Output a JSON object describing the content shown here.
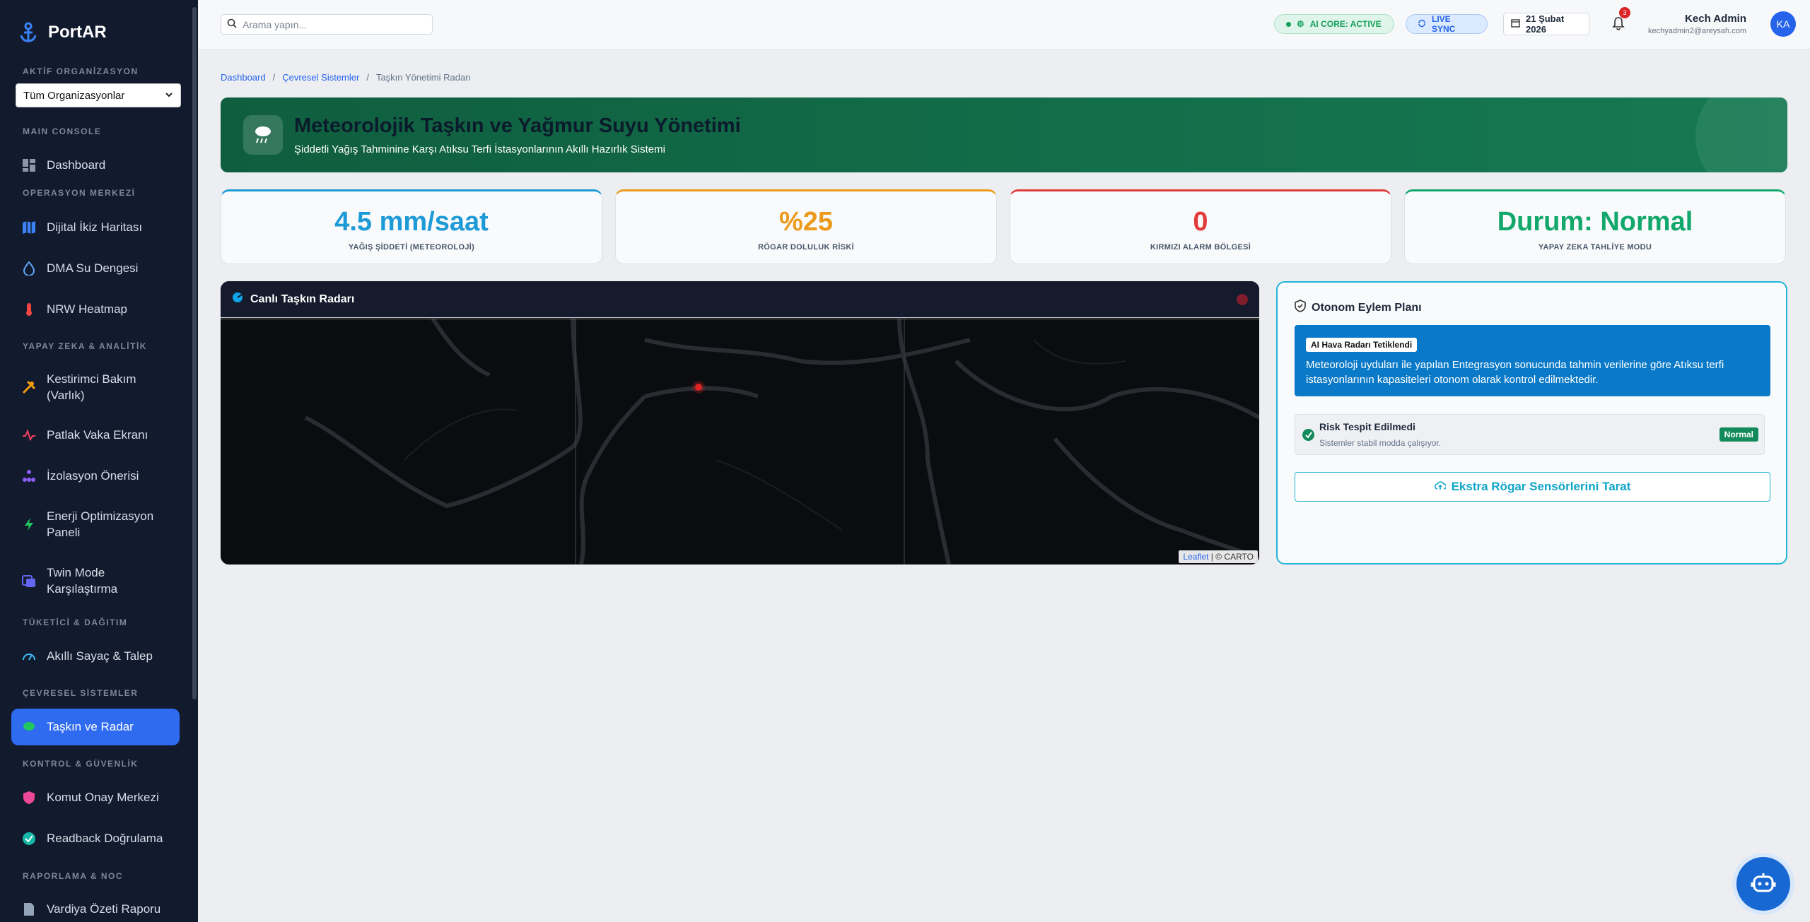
{
  "brand": {
    "name": "PortAR"
  },
  "sidebar": {
    "org_label": "AKTİF ORGANİZASYON",
    "org_value": "Tüm Organizasyonlar",
    "sections": {
      "main": "MAIN CONSOLE",
      "ops": "OPERASYON MERKEZİ",
      "ai": "YAPAY ZEKA & ANALİTİK",
      "consumer": "TÜKETİCİ & DAĞITIM",
      "env": "ÇEVRESEL SİSTEMLER",
      "control": "KONTROL & GÜVENLİK",
      "report": "RAPORLAMA & NOC"
    },
    "items": {
      "dashboard": "Dashboard",
      "digital_twin": "Dijital İkiz Haritası",
      "dma": "DMA Su Dengesi",
      "nrw": "NRW Heatmap",
      "predictive_1": "Kestirimci Bakım",
      "predictive_2": "(Varlık)",
      "burst": "Patlak Vaka Ekranı",
      "isolation": "İzolasyon Önerisi",
      "energy_1": "Enerji Optimizasyon",
      "energy_2": "Paneli",
      "twin_1": "Twin Mode",
      "twin_2": "Karşılaştırma",
      "meter": "Akıllı Sayaç & Talep",
      "flood": "Taşkın ve Radar",
      "approval": "Komut Onay Merkezi",
      "readback": "Readback Doğrulama",
      "shift": "Vardiya Özeti Raporu"
    }
  },
  "topbar": {
    "search_placeholder": "Arama yapın...",
    "ai_core": "AI CORE: ACTIVE",
    "live_sync": "LIVE SYNC",
    "date": "21 Şubat 2026",
    "notif_count": "3",
    "user_name": "Kech Admin",
    "user_email": "kechyadmin2@areysah.com",
    "avatar": "KA"
  },
  "breadcrumb": {
    "home": "Dashboard",
    "parent": "Çevresel Sistemler",
    "current": "Taşkın Yönetimi Radarı",
    "sep": "/"
  },
  "hero": {
    "title": "Meteorolojik Taşkın ve Yağmur Suyu Yönetimi",
    "subtitle": "Şiddetli Yağış Tahminine Karşı Atıksu Terfi İstasyonlarının Akıllı Hazırlık Sistemi"
  },
  "stats": [
    {
      "value": "4.5 mm/saat",
      "label": "YAĞIŞ ŞİDDETİ (METEOROLOJİ)",
      "color": "#1e9bd7"
    },
    {
      "value": "%25",
      "label": "RÖGAR DOLULUK RİSKİ",
      "color": "#ec9a1b"
    },
    {
      "value": "0",
      "label": "KIRMIZI ALARM BÖLGESİ",
      "color": "#e23b3b"
    },
    {
      "value": "Durum: Normal",
      "label": "YAPAY ZEKA TAHLİYE MODU",
      "color": "#12a86b"
    }
  ],
  "map": {
    "title": "Canlı Taşkın Radarı",
    "attrib_link": "Leaflet",
    "attrib_rest": "| © CARTO"
  },
  "plan": {
    "title": "Otonom Eylem Planı",
    "alert_tag": "AI Hava Radarı Tetiklendi",
    "alert_text": "Meteoroloji uyduları ile yapılan Entegrasyon sonucunda tahmin verilerine göre Atıksu terfi istasyonlarının kapasiteleri otonom olarak kontrol edilmektedir.",
    "risk_title": "Risk Tespit Edilmedi",
    "risk_sub": "Sistemler stabil modda çalışıyor.",
    "risk_badge": "Normal",
    "scan_button": "Ekstra Rögar Sensörlerini Tarat"
  },
  "colors": {
    "sidebar_bg": "#121b2e",
    "active": "#2f6bf0",
    "hero": "#0f5e3f",
    "accent_cyan": "#22b5d6"
  }
}
